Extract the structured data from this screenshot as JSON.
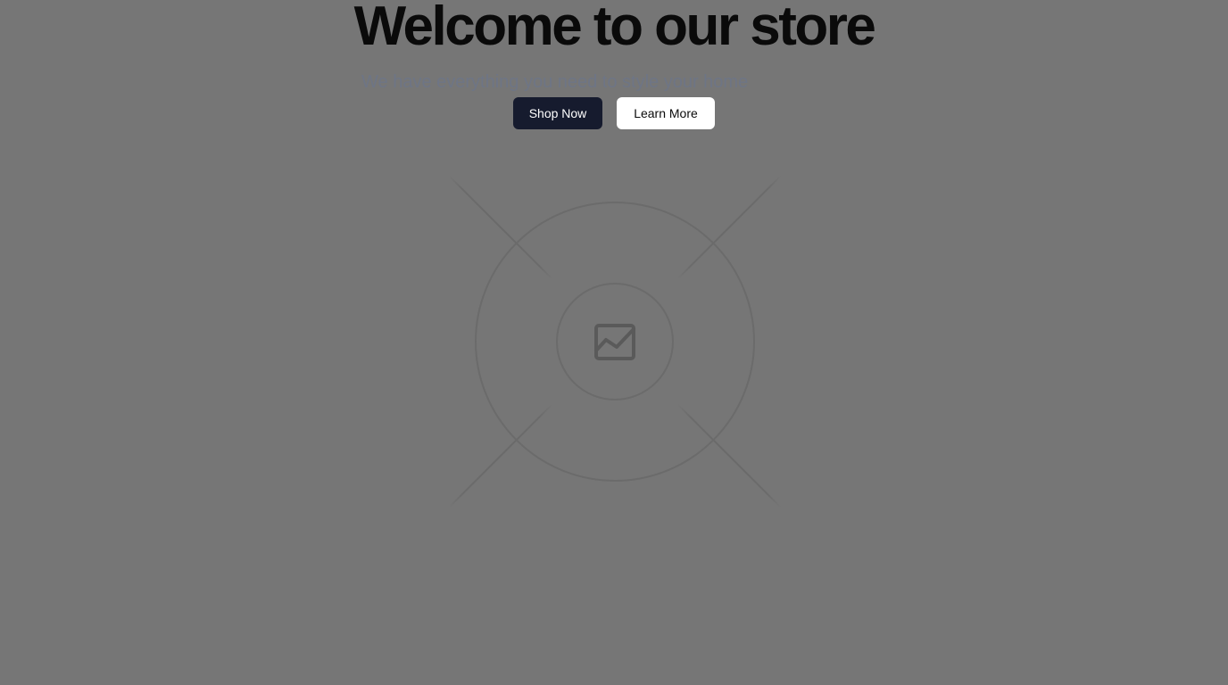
{
  "hero": {
    "title": "Welcome to our store",
    "subtitle": "We have everything you need to style your home",
    "primary_button": "Shop Now",
    "secondary_button": "Learn More"
  },
  "image_placeholder": {
    "icon": "image-icon"
  },
  "colors": {
    "backdrop": "#767676",
    "primary_button_bg": "#161b2e",
    "secondary_button_bg": "#ffffff",
    "subtitle_text": "#6e7585"
  }
}
